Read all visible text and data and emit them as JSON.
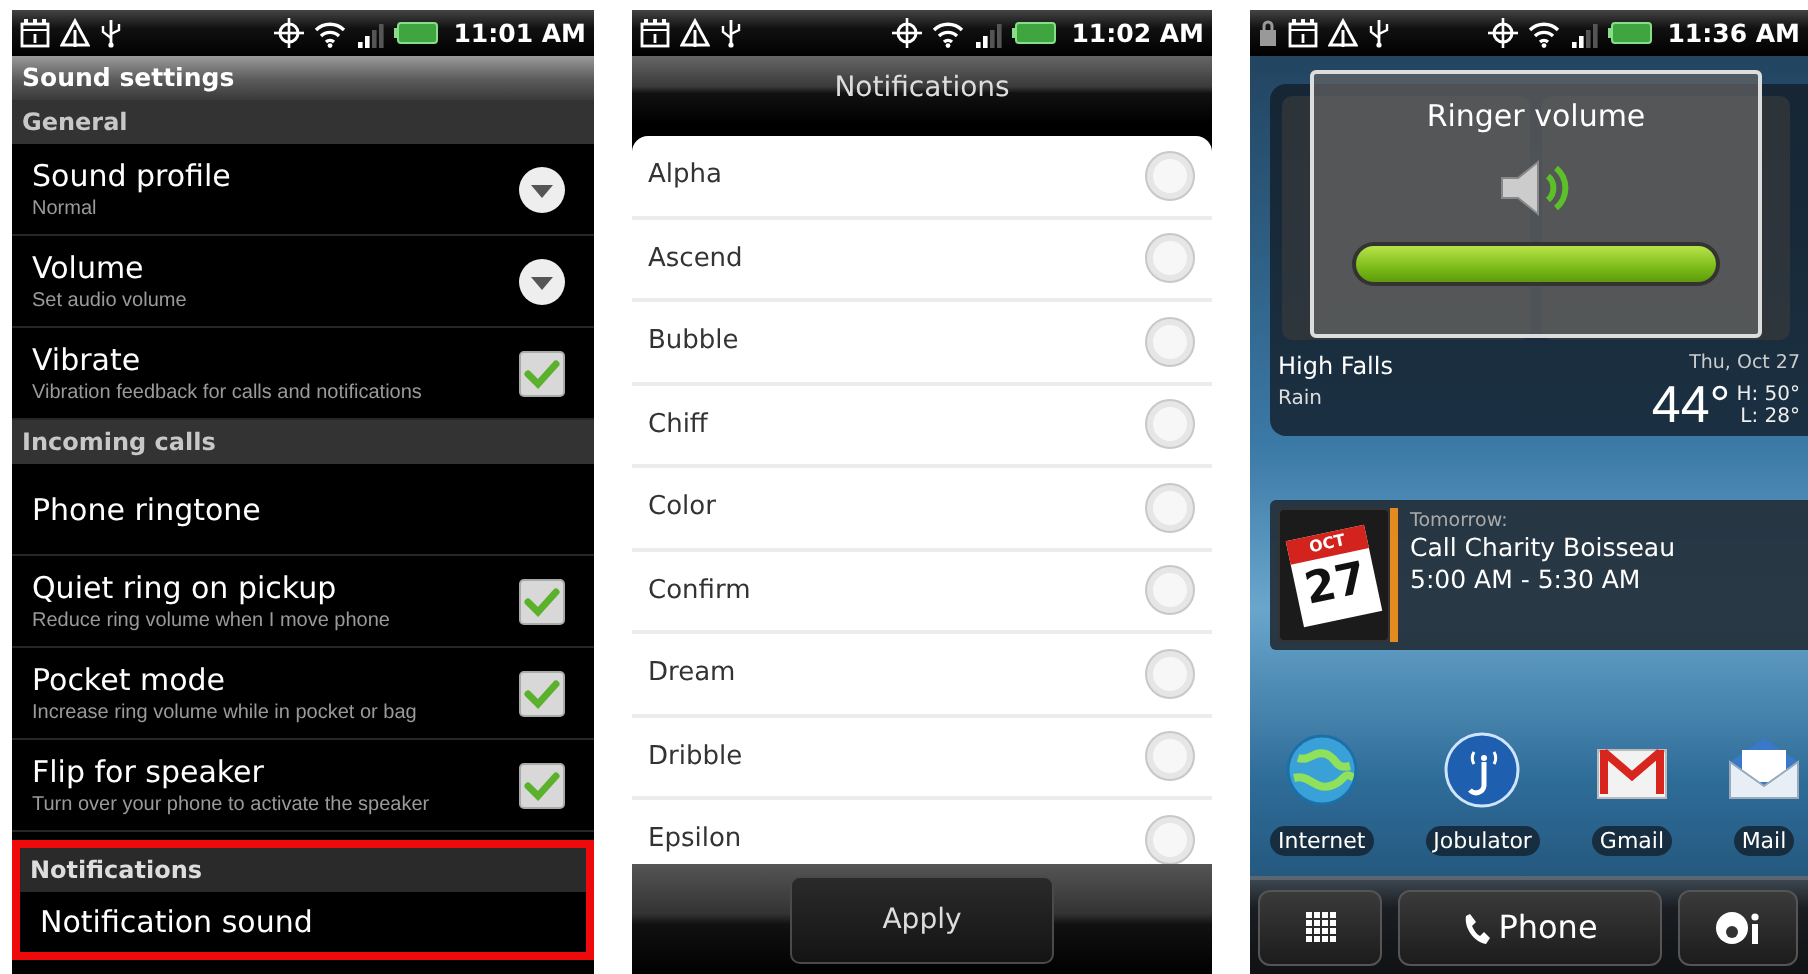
{
  "screens": [
    {
      "kind": "settings",
      "status_bar": {
        "time": "11:01 AM"
      },
      "title": "Sound settings",
      "sections": [
        {
          "header": "General",
          "highlighted": false,
          "items": [
            {
              "kind": "dropdown",
              "title": "Sound profile",
              "subtitle": "Normal"
            },
            {
              "kind": "dropdown",
              "title": "Volume",
              "subtitle": "Set audio volume"
            },
            {
              "kind": "checkbox",
              "title": "Vibrate",
              "subtitle": "Vibration feedback for calls and notifications",
              "checked": true
            }
          ]
        },
        {
          "header": "Incoming calls",
          "highlighted": false,
          "items": [
            {
              "kind": "plain",
              "title": "Phone ringtone"
            },
            {
              "kind": "checkbox",
              "title": "Quiet ring on pickup",
              "subtitle": "Reduce ring volume when I move phone",
              "checked": true
            },
            {
              "kind": "checkbox",
              "title": "Pocket mode",
              "subtitle": "Increase ring volume while in pocket or bag",
              "checked": true
            },
            {
              "kind": "checkbox",
              "title": "Flip for speaker",
              "subtitle": "Turn over your phone to activate the speaker",
              "checked": true
            }
          ]
        },
        {
          "header": "Notifications",
          "highlighted": true,
          "items": [
            {
              "kind": "plain",
              "title": "Notification sound"
            }
          ]
        }
      ]
    },
    {
      "kind": "picker",
      "status_bar": {
        "time": "11:02 AM"
      },
      "title": "Notifications",
      "options": [
        {
          "label": "Alpha",
          "selected": false
        },
        {
          "label": "Ascend",
          "selected": false
        },
        {
          "label": "Bubble",
          "selected": false
        },
        {
          "label": "Chiff",
          "selected": false
        },
        {
          "label": "Color",
          "selected": false
        },
        {
          "label": "Confirm",
          "selected": false
        },
        {
          "label": "Dream",
          "selected": false
        },
        {
          "label": "Dribble",
          "selected": false
        },
        {
          "label": "Epsilon",
          "selected": false
        }
      ],
      "button": "Apply"
    },
    {
      "kind": "home",
      "status_bar": {
        "time": "11:36 AM"
      },
      "clock": {
        "date": "Thu, Oct 27"
      },
      "weather": {
        "city": "High Falls",
        "condition": "Rain",
        "temperature": "44°",
        "high": "H: 50°",
        "low": "L: 28°"
      },
      "volume_popup": {
        "title": "Ringer volume",
        "level": 1
      },
      "event": {
        "month": "OCT",
        "day": "27",
        "when": "Tomorrow:",
        "title": "Call Charity Boisseau",
        "time": "5:00 AM - 5:30 AM"
      },
      "apps": [
        "Internet",
        "Jobulator",
        "Gmail",
        "Mail"
      ],
      "dock": {
        "phone": "Phone"
      }
    }
  ]
}
